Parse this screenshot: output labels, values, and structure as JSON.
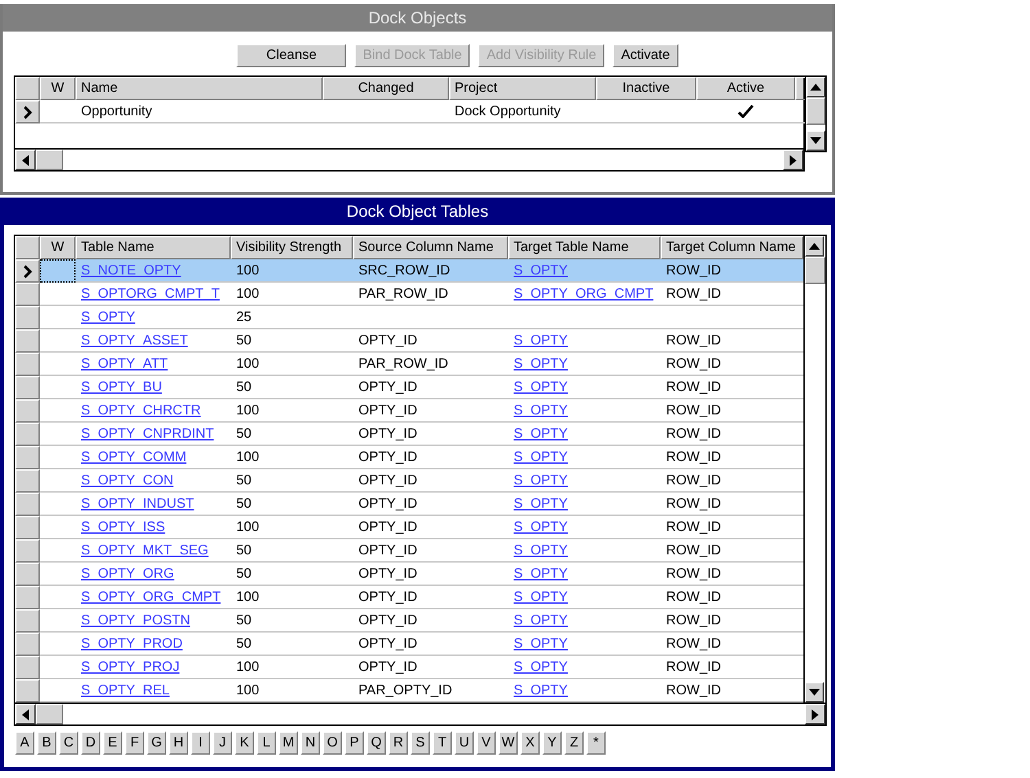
{
  "dock_objects": {
    "title": "Dock Objects",
    "buttons": [
      {
        "label": "Cleanse",
        "disabled": false
      },
      {
        "label": "Bind Dock Table",
        "disabled": true
      },
      {
        "label": "Add Visibility Rule",
        "disabled": true
      },
      {
        "label": "Activate",
        "disabled": false
      }
    ],
    "columns": [
      "W",
      "Name",
      "Changed",
      "Project",
      "Inactive",
      "Active"
    ],
    "rows": [
      {
        "selected": true,
        "name": "Opportunity",
        "project": "Dock Opportunity",
        "inactive": false,
        "active": true
      }
    ]
  },
  "dock_object_tables": {
    "title": "Dock Object Tables",
    "columns": [
      "W",
      "Table Name",
      "Visibility Strength",
      "Source Column Name",
      "Target Table Name",
      "Target Column Name"
    ],
    "rows": [
      {
        "selected": true,
        "table_name": "S_NOTE_OPTY",
        "visibility_strength": "100",
        "source_column": "SRC_ROW_ID",
        "target_table": "S_OPTY",
        "target_column": "ROW_ID"
      },
      {
        "selected": false,
        "table_name": "S_OPTORG_CMPT_T",
        "visibility_strength": "100",
        "source_column": "PAR_ROW_ID",
        "target_table": "S_OPTY_ORG_CMPT",
        "target_column": "ROW_ID"
      },
      {
        "selected": false,
        "table_name": "S_OPTY",
        "visibility_strength": "25"
      },
      {
        "selected": false,
        "table_name": "S_OPTY_ASSET",
        "visibility_strength": "50",
        "source_column": "OPTY_ID",
        "target_table": "S_OPTY",
        "target_column": "ROW_ID"
      },
      {
        "selected": false,
        "table_name": "S_OPTY_ATT",
        "visibility_strength": "100",
        "source_column": "PAR_ROW_ID",
        "target_table": "S_OPTY",
        "target_column": "ROW_ID"
      },
      {
        "selected": false,
        "table_name": "S_OPTY_BU",
        "visibility_strength": "50",
        "source_column": "OPTY_ID",
        "target_table": "S_OPTY",
        "target_column": "ROW_ID"
      },
      {
        "selected": false,
        "table_name": "S_OPTY_CHRCTR",
        "visibility_strength": "100",
        "source_column": "OPTY_ID",
        "target_table": "S_OPTY",
        "target_column": "ROW_ID"
      },
      {
        "selected": false,
        "table_name": "S_OPTY_CNPRDINT",
        "visibility_strength": "50",
        "source_column": "OPTY_ID",
        "target_table": "S_OPTY",
        "target_column": "ROW_ID"
      },
      {
        "selected": false,
        "table_name": "S_OPTY_COMM",
        "visibility_strength": "100",
        "source_column": "OPTY_ID",
        "target_table": "S_OPTY",
        "target_column": "ROW_ID"
      },
      {
        "selected": false,
        "table_name": "S_OPTY_CON",
        "visibility_strength": "50",
        "source_column": "OPTY_ID",
        "target_table": "S_OPTY",
        "target_column": "ROW_ID"
      },
      {
        "selected": false,
        "table_name": "S_OPTY_INDUST",
        "visibility_strength": "50",
        "source_column": "OPTY_ID",
        "target_table": "S_OPTY",
        "target_column": "ROW_ID"
      },
      {
        "selected": false,
        "table_name": "S_OPTY_ISS",
        "visibility_strength": "100",
        "source_column": "OPTY_ID",
        "target_table": "S_OPTY",
        "target_column": "ROW_ID"
      },
      {
        "selected": false,
        "table_name": "S_OPTY_MKT_SEG",
        "visibility_strength": "50",
        "source_column": "OPTY_ID",
        "target_table": "S_OPTY",
        "target_column": "ROW_ID"
      },
      {
        "selected": false,
        "table_name": "S_OPTY_ORG",
        "visibility_strength": "50",
        "source_column": "OPTY_ID",
        "target_table": "S_OPTY",
        "target_column": "ROW_ID"
      },
      {
        "selected": false,
        "table_name": "S_OPTY_ORG_CMPT",
        "visibility_strength": "100",
        "source_column": "OPTY_ID",
        "target_table": "S_OPTY",
        "target_column": "ROW_ID"
      },
      {
        "selected": false,
        "table_name": "S_OPTY_POSTN",
        "visibility_strength": "50",
        "source_column": "OPTY_ID",
        "target_table": "S_OPTY",
        "target_column": "ROW_ID"
      },
      {
        "selected": false,
        "table_name": "S_OPTY_PROD",
        "visibility_strength": "50",
        "source_column": "OPTY_ID",
        "target_table": "S_OPTY",
        "target_column": "ROW_ID"
      },
      {
        "selected": false,
        "table_name": "S_OPTY_PROJ",
        "visibility_strength": "100",
        "source_column": "OPTY_ID",
        "target_table": "S_OPTY",
        "target_column": "ROW_ID"
      },
      {
        "selected": false,
        "table_name": "S_OPTY_REL",
        "visibility_strength": "100",
        "source_column": "PAR_OPTY_ID",
        "target_table": "S_OPTY",
        "target_column": "ROW_ID"
      }
    ],
    "alphabet": [
      "A",
      "B",
      "C",
      "D",
      "E",
      "F",
      "G",
      "H",
      "I",
      "J",
      "K",
      "L",
      "M",
      "N",
      "O",
      "P",
      "Q",
      "R",
      "S",
      "T",
      "U",
      "V",
      "W",
      "X",
      "Y",
      "Z",
      "*"
    ]
  }
}
